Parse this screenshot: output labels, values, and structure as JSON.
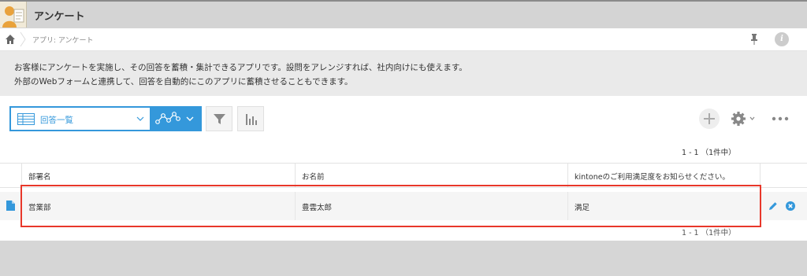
{
  "app": {
    "title": "アンケート"
  },
  "breadcrumb": {
    "path": "アプリ: アンケート"
  },
  "info": {
    "glyph": "i"
  },
  "description": {
    "line1": "お客様にアンケートを実施し、その回答を蓄積・集計できるアプリです。設問をアレンジすれば、社内向けにも使えます。",
    "line2": "外部のWebフォームと連携して、回答を自動的にこのアプリに蓄積させることもできます。"
  },
  "toolbar": {
    "view_label": "回答一覧",
    "icons": [
      "table-view-icon",
      "chevron-down-icon",
      "graph-icon",
      "filter-icon",
      "bar-chart-icon",
      "plus-icon",
      "gear-icon",
      "more-icon"
    ]
  },
  "pagination": {
    "top": "1 - 1 （1件中）",
    "bottom": "1 - 1 （1件中）"
  },
  "table": {
    "columns": [
      "部署名",
      "お名前",
      "kintoneのご利用満足度をお知らせください。"
    ],
    "rows": [
      {
        "cells": [
          "営業部",
          "豊雲太郎",
          "満足"
        ]
      }
    ]
  },
  "colors": {
    "accent": "#3498db",
    "highlight": "#e8372a"
  }
}
